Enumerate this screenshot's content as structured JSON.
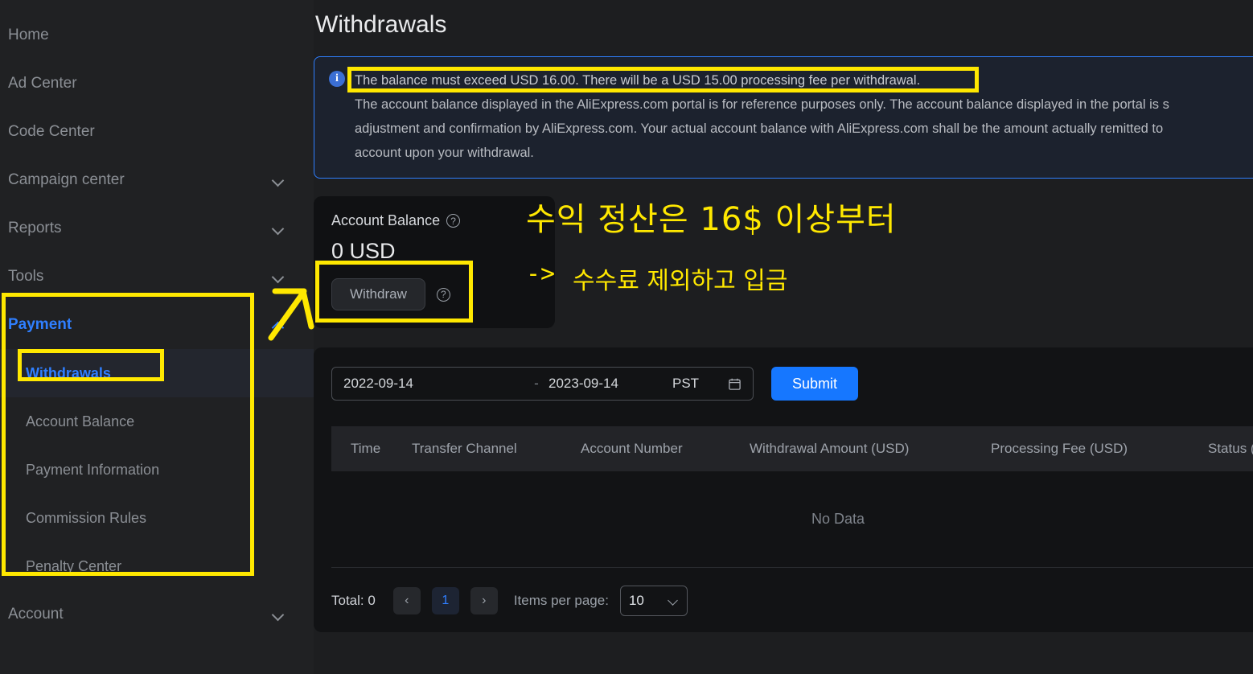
{
  "sidebar": {
    "items": [
      {
        "label": "Home",
        "expandable": false
      },
      {
        "label": "Ad Center",
        "expandable": false
      },
      {
        "label": "Code Center",
        "expandable": false
      },
      {
        "label": "Campaign center",
        "expandable": true
      },
      {
        "label": "Reports",
        "expandable": true
      },
      {
        "label": "Tools",
        "expandable": true
      }
    ],
    "payment": {
      "label": "Payment"
    },
    "payment_children": [
      {
        "label": "Withdrawals",
        "active": true
      },
      {
        "label": "Account Balance",
        "active": false
      },
      {
        "label": "Payment Information",
        "active": false
      },
      {
        "label": "Commission Rules",
        "active": false
      },
      {
        "label": "Penalty Center",
        "active": false
      }
    ],
    "account": {
      "label": "Account"
    }
  },
  "main": {
    "title": "Withdrawals",
    "banner": {
      "icon": "info-icon",
      "line1": "The balance must exceed USD 16.00. There will be a USD 15.00 processing fee per withdrawal.",
      "line2": "The account balance displayed in the AliExpress.com portal is for reference purposes only. The account balance displayed in the portal is s",
      "line3": "adjustment and confirmation by AliExpress.com. Your actual account balance with AliExpress.com shall be the amount actually remitted to",
      "line4": "account upon your withdrawal."
    },
    "balance_card": {
      "title": "Account Balance",
      "help_icon": "question-mark-icon",
      "amount": "0 USD",
      "withdraw_label": "Withdraw",
      "withdraw_help_icon": "question-mark-icon"
    },
    "filter": {
      "date_start": "2022-09-14",
      "date_separator": "-",
      "date_end": "2023-09-14",
      "timezone": "PST",
      "calendar_icon": "calendar-icon",
      "submit_label": "Submit"
    },
    "table": {
      "columns": [
        "Time",
        "Transfer Channel",
        "Account Number",
        "Withdrawal Amount (USD)",
        "Processing Fee (USD)",
        "Status ("
      ],
      "rows": [],
      "empty_text": "No Data"
    },
    "pagination": {
      "total_label": "Total: 0",
      "prev_icon": "chevron-left-icon",
      "current_page": "1",
      "next_icon": "chevron-right-icon",
      "items_per_page_label": "Items per page:",
      "items_per_page_value": "10",
      "select_chevron_icon": "chevron-down-icon"
    }
  },
  "annotations": {
    "highlight_color": "#ffe800",
    "note_line1": "수익 정산은 16$ 이상부터",
    "note_line2": "->",
    "note_line3": "수수료 제외하고 입금",
    "arrow_icon": "arrow-up-right-icon"
  }
}
